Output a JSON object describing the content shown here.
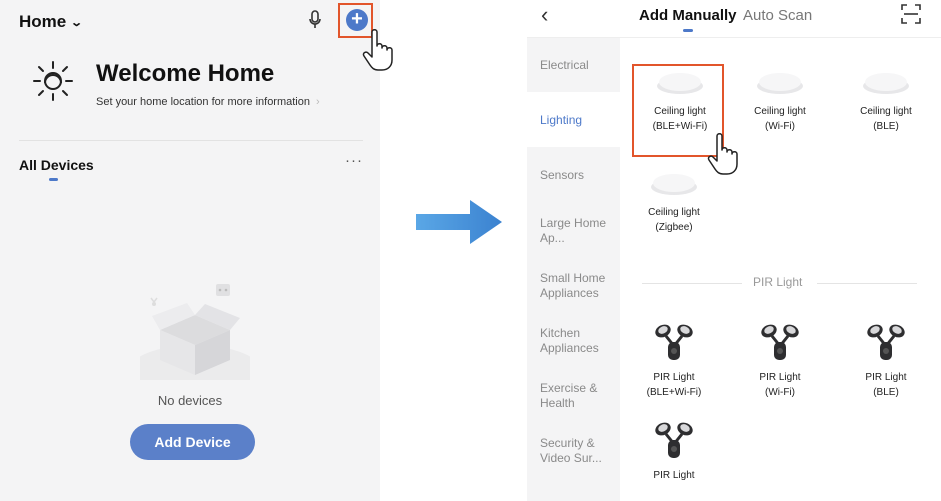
{
  "left": {
    "home_label": "Home",
    "welcome_title": "Welcome Home",
    "welcome_sub": "Set your home location for more information",
    "all_devices_label": "All Devices",
    "more_label": "···",
    "empty_label": "No devices",
    "add_device_label": "Add Device",
    "plus_label": "+"
  },
  "right": {
    "back_label": "‹",
    "tabs": [
      "Add Manually",
      "Auto Scan"
    ],
    "categories": [
      "Electrical",
      "Lighting",
      "Sensors",
      "Large Home Ap...",
      "Small Home Appliances",
      "Kitchen Appliances",
      "Exercise & Health",
      "Security & Video Sur..."
    ],
    "active_category": "Lighting",
    "ceiling_devices": [
      {
        "line1": "Ceiling light",
        "line2": "(BLE+Wi-Fi)"
      },
      {
        "line1": "Ceiling light",
        "line2": "(Wi-Fi)"
      },
      {
        "line1": "Ceiling light",
        "line2": "(BLE)"
      },
      {
        "line1": "Ceiling light",
        "line2": "(Zigbee)"
      }
    ],
    "section_title": "PIR Light",
    "pir_devices": [
      {
        "line1": "PIR Light",
        "line2": "(BLE+Wi-Fi)"
      },
      {
        "line1": "PIR Light",
        "line2": "(Wi-Fi)"
      },
      {
        "line1": "PIR Light",
        "line2": "(BLE)"
      },
      {
        "line1": "PIR Light",
        "line2": ""
      }
    ]
  },
  "colors": {
    "accent": "#4d79c9",
    "highlight_box": "#e2552b",
    "arrow": "#4a90d9"
  }
}
